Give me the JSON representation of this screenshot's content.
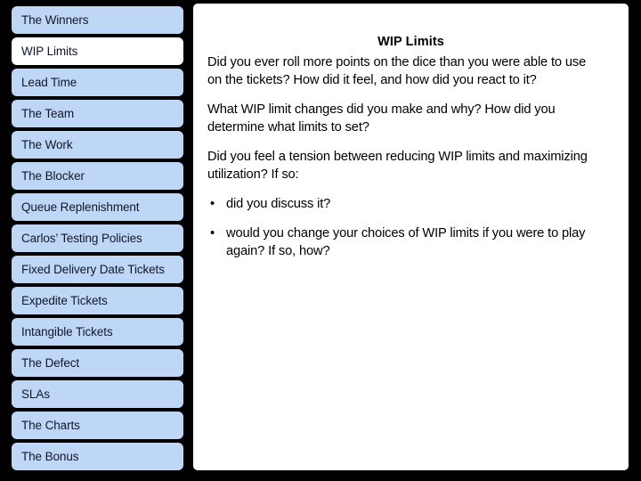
{
  "sidebar": {
    "items": [
      {
        "label": "The Winners",
        "selected": false
      },
      {
        "label": "WIP Limits",
        "selected": true
      },
      {
        "label": "Lead Time",
        "selected": false
      },
      {
        "label": "The Team",
        "selected": false
      },
      {
        "label": "The Work",
        "selected": false
      },
      {
        "label": "The Blocker",
        "selected": false
      },
      {
        "label": "Queue Replenishment",
        "selected": false
      },
      {
        "label": "Carlos’ Testing Policies",
        "selected": false
      },
      {
        "label": "Fixed Delivery Date Tickets",
        "selected": false
      },
      {
        "label": "Expedite Tickets",
        "selected": false
      },
      {
        "label": "Intangible Tickets",
        "selected": false
      },
      {
        "label": "The Defect",
        "selected": false
      },
      {
        "label": "SLAs",
        "selected": false
      },
      {
        "label": "The Charts",
        "selected": false
      },
      {
        "label": "The Bonus",
        "selected": false
      }
    ]
  },
  "content": {
    "title": "WIP Limits",
    "paragraphs": [
      "Did you ever roll more points on the dice than you were able to use on the tickets? How did it feel, and how did you react to it?",
      "What WIP limit changes did you make and why? How did you determine what limits to set?",
      "Did you feel a tension between reducing WIP limits and maximizing utilization? If so:"
    ],
    "bullet_mark": "•",
    "bullets": [
      "did you discuss it?",
      "would you change your choices of WIP limits if you were to play again? If so, how?"
    ]
  },
  "colors": {
    "background": "#000000",
    "nav_item": "#bfd7f7",
    "nav_item_selected": "#ffffff",
    "panel": "#ffffff",
    "text": "#000000"
  }
}
